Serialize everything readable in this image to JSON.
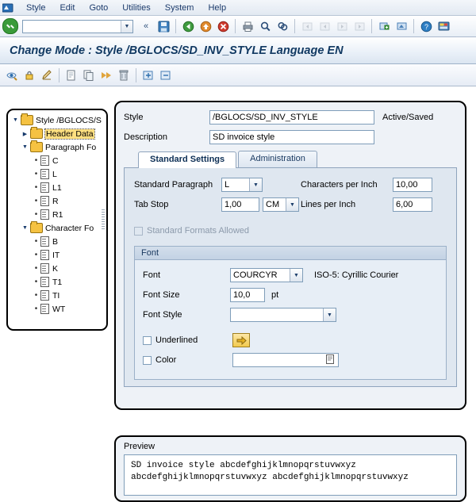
{
  "menubar": {
    "system_icon": "sap-logo-icon",
    "items": [
      "Style",
      "Edit",
      "Goto",
      "Utilities",
      "System",
      "Help"
    ]
  },
  "toolbar": {
    "ok_button": "ok-check",
    "command_value": "",
    "command_placeholder": "",
    "buttons": [
      "save-icon",
      "back-icon",
      "exit-icon",
      "cancel-icon",
      "print-icon",
      "find-icon",
      "find-next-icon",
      "first-page-icon",
      "previous-page-icon",
      "next-page-icon",
      "last-page-icon",
      "create-session-icon",
      "create-shortcut-icon",
      "help-icon",
      "customize-layout-icon"
    ]
  },
  "title": "Change Mode : Style /BGLOCS/SD_INV_STYLE Language EN",
  "apptoolbar": {
    "buttons": [
      "display-change-icon",
      "lock-icon",
      "edit-icon",
      "create-icon",
      "copy-icon",
      "forward-icon",
      "delete-icon",
      "expand-icon",
      "collapse-icon"
    ]
  },
  "tree": {
    "nodes": [
      {
        "label": "Style /BGLOCS/S",
        "level": 0,
        "type": "root",
        "expanded": true,
        "selected": false
      },
      {
        "label": "Header Data",
        "level": 1,
        "type": "folder",
        "expanded": false,
        "selected": true
      },
      {
        "label": "Paragraph Fo",
        "level": 1,
        "type": "folder",
        "expanded": true,
        "selected": false
      },
      {
        "label": "C",
        "level": 2,
        "type": "doc",
        "selected": false
      },
      {
        "label": "L",
        "level": 2,
        "type": "doc",
        "selected": false
      },
      {
        "label": "L1",
        "level": 2,
        "type": "doc",
        "selected": false
      },
      {
        "label": "R",
        "level": 2,
        "type": "doc",
        "selected": false
      },
      {
        "label": "R1",
        "level": 2,
        "type": "doc",
        "selected": false
      },
      {
        "label": "Character Fo",
        "level": 1,
        "type": "folder",
        "expanded": true,
        "selected": false
      },
      {
        "label": "B",
        "level": 2,
        "type": "doc",
        "selected": false
      },
      {
        "label": "IT",
        "level": 2,
        "type": "doc",
        "selected": false
      },
      {
        "label": "K",
        "level": 2,
        "type": "doc",
        "selected": false
      },
      {
        "label": "T1",
        "level": 2,
        "type": "doc",
        "selected": false
      },
      {
        "label": "TI",
        "level": 2,
        "type": "doc",
        "selected": false
      },
      {
        "label": "WT",
        "level": 2,
        "type": "doc",
        "selected": false
      }
    ]
  },
  "form": {
    "style_label": "Style",
    "style_value": "/BGLOCS/SD_INV_STYLE",
    "status_text": "Active/Saved",
    "description_label": "Description",
    "description_value": "SD invoice style",
    "tabs": [
      {
        "label": "Standard Settings",
        "active": true
      },
      {
        "label": "Administration",
        "active": false
      }
    ],
    "standard_paragraph_label": "Standard Paragraph",
    "standard_paragraph_value": "L",
    "tab_stop_label": "Tab Stop",
    "tab_stop_value": "1,00",
    "tab_stop_unit": "CM",
    "characters_per_inch_label": "Characters per Inch",
    "characters_per_inch_value": "10,00",
    "lines_per_inch_label": "Lines per Inch",
    "lines_per_inch_value": "6,00",
    "standard_formats_label": "Standard Formats Allowed",
    "standard_formats_checked": false,
    "font_group_title": "Font",
    "font_label": "Font",
    "font_value": "COURCYR",
    "font_note": "ISO-5: Cyrillic Courier",
    "font_size_label": "Font Size",
    "font_size_value": "10,0",
    "font_size_unit": "pt",
    "font_style_label": "Font Style",
    "font_style_value": "",
    "underlined_label": "Underlined",
    "underlined_checked": false,
    "underline_button_icon": "arrow-right-icon",
    "color_label": "Color",
    "color_checked": false,
    "color_value": "",
    "color_picker_icon": "color-palette-icon"
  },
  "preview": {
    "label": "Preview",
    "line1": "SD invoice style abcdefghijklmnopqrstuvwxyz",
    "line2": "abcdefghijklmnopqrstuvwxyz abcdefghijklmnopqrstuvwxyz"
  },
  "colors": {
    "accent": "#113962",
    "panel_border": "#000000",
    "tab_active_bg": "#ffffff",
    "selection_bg": "#ffdf80",
    "ok_green": "#3a9b3a"
  }
}
